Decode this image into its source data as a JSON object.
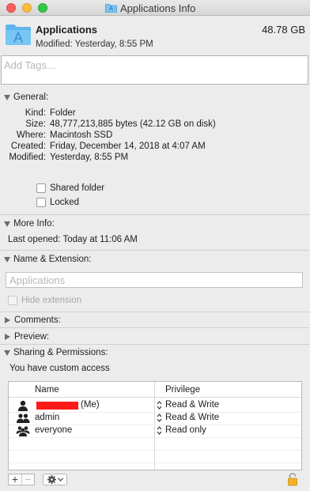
{
  "window": {
    "title": "Applications Info"
  },
  "header": {
    "name": "Applications",
    "size": "48.78 GB",
    "modified": "Modified: Yesterday, 8:55 PM"
  },
  "tags": {
    "placeholder": "Add Tags..."
  },
  "general": {
    "title": "General:",
    "rows": [
      {
        "key": "Kind:",
        "value": "Folder"
      },
      {
        "key": "Size:",
        "value": "48,777,213,885 bytes (42.12 GB on disk)"
      },
      {
        "key": "Where:",
        "value": "Macintosh SSD"
      },
      {
        "key": "Created:",
        "value": "Friday, December 14, 2018 at 4:07 AM"
      },
      {
        "key": "Modified:",
        "value": "Yesterday, 8:55 PM"
      }
    ],
    "shared_folder": "Shared folder",
    "locked": "Locked"
  },
  "more_info": {
    "title": "More Info:",
    "last_opened": "Last opened: Today at 11:06 AM"
  },
  "name_ext": {
    "title": "Name & Extension:",
    "field_placeholder": "Applications",
    "hide_extension": "Hide extension"
  },
  "comments": {
    "title": "Comments:"
  },
  "preview": {
    "title": "Preview:"
  },
  "sharing": {
    "title": "Sharing & Permissions:",
    "access_text": "You have custom access",
    "col_name": "Name",
    "col_privilege": "Privilege",
    "rows": [
      {
        "name": "",
        "suffix": "(Me)",
        "privilege": "Read & Write",
        "icon": "user-icon"
      },
      {
        "name": "admin",
        "suffix": "",
        "privilege": "Read & Write",
        "icon": "group-icon"
      },
      {
        "name": "everyone",
        "suffix": "",
        "privilege": "Read only",
        "icon": "group-everyone-icon"
      }
    ]
  },
  "bottom": {
    "add": "+",
    "remove": "−"
  },
  "colors": {
    "redaction": "#ff1a1a",
    "folder_blue": "#5fb5ed"
  }
}
